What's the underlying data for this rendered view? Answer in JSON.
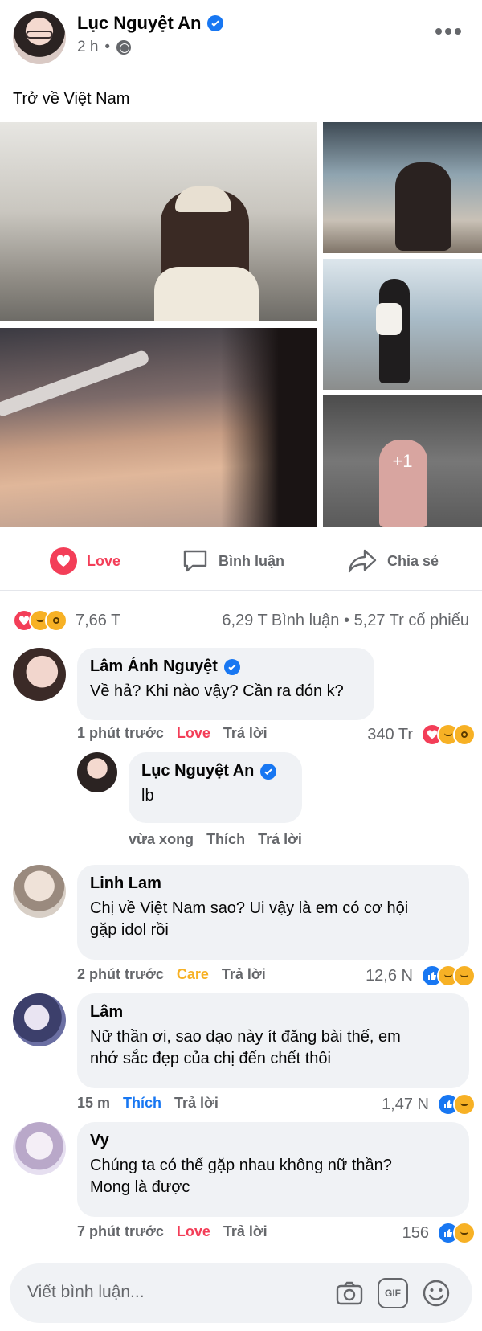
{
  "post": {
    "author": "Lục Nguyệt An",
    "time": "2 h",
    "separator": "•",
    "text": "Trở về Việt Nam",
    "photos_more": "+1"
  },
  "actions": {
    "love": "Love",
    "comment": "Bình luận",
    "share": "Chia sẻ"
  },
  "summary": {
    "reaction_count": "7,66 T",
    "comments": "6,29 T Bình luận",
    "shares": "5,27 Tr cổ phiếu",
    "dot": "•"
  },
  "comments": [
    {
      "name": "Lâm Ánh Nguyệt",
      "text": "Về hả? Khi nào vậy? Cần ra đón k?",
      "time": "1 phút trước",
      "reaction_label": "Love",
      "reply": "Trả lời",
      "count": "340 Tr"
    },
    {
      "name": "Lục Nguyệt An",
      "text": "lb",
      "time": "vừa xong",
      "reaction_label": "Thích",
      "reply": "Trả lời"
    },
    {
      "name": "Linh Lam",
      "text_line1": "Chị về Việt Nam sao? Ui vậy là em có cơ hội",
      "text_line2": "gặp idol rồi",
      "time": "2 phút trước",
      "reaction_label": "Care",
      "reply": "Trả lời",
      "count": "12,6 N"
    },
    {
      "name": "Lâm",
      "text_line1": "Nữ thần ơi, sao dạo này ít đăng bài thế, em",
      "text_line2": "nhớ sắc đẹp của chị đến chết thôi",
      "time": "15 m",
      "reaction_label": "Thích",
      "reply": "Trả lời",
      "count": "1,47 N"
    },
    {
      "name": "Vy",
      "text_line1": "Chúng ta có thể gặp nhau không nữ thần?",
      "text_line2": "Mong là được",
      "time": "7 phút trước",
      "reaction_label": "Love",
      "reply": "Trả lời",
      "count": "156"
    }
  ],
  "composer": {
    "placeholder": "Viết bình luận...",
    "gif": "GIF"
  },
  "colors": {
    "love": "#f33e58",
    "like": "#1877f2",
    "care": "#f7b125",
    "muted": "#65676b",
    "bubble": "#f0f2f5"
  },
  "icons": [
    "verified-icon",
    "globe-icon",
    "more-icon",
    "heart-icon",
    "comment-icon",
    "share-icon",
    "camera-icon",
    "gif-icon",
    "emoji-icon"
  ]
}
